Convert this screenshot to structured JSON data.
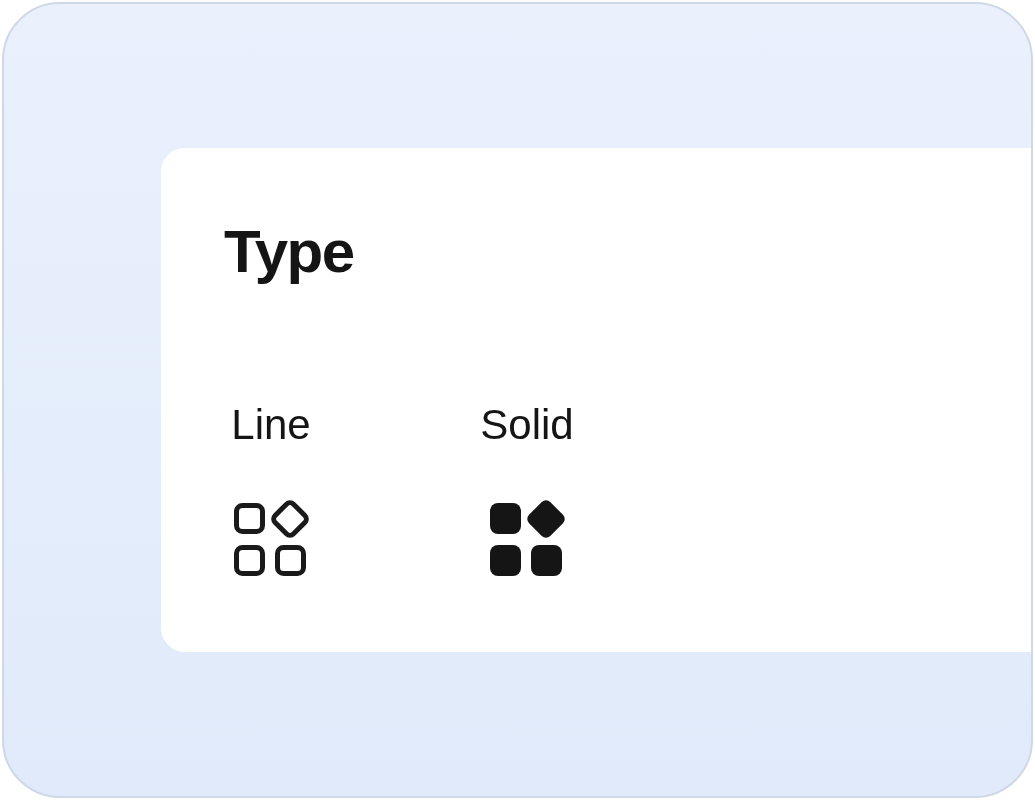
{
  "panel": {
    "title": "Type",
    "options": [
      {
        "label": "Line",
        "kind": "line"
      },
      {
        "label": "Solid",
        "kind": "solid"
      }
    ]
  }
}
